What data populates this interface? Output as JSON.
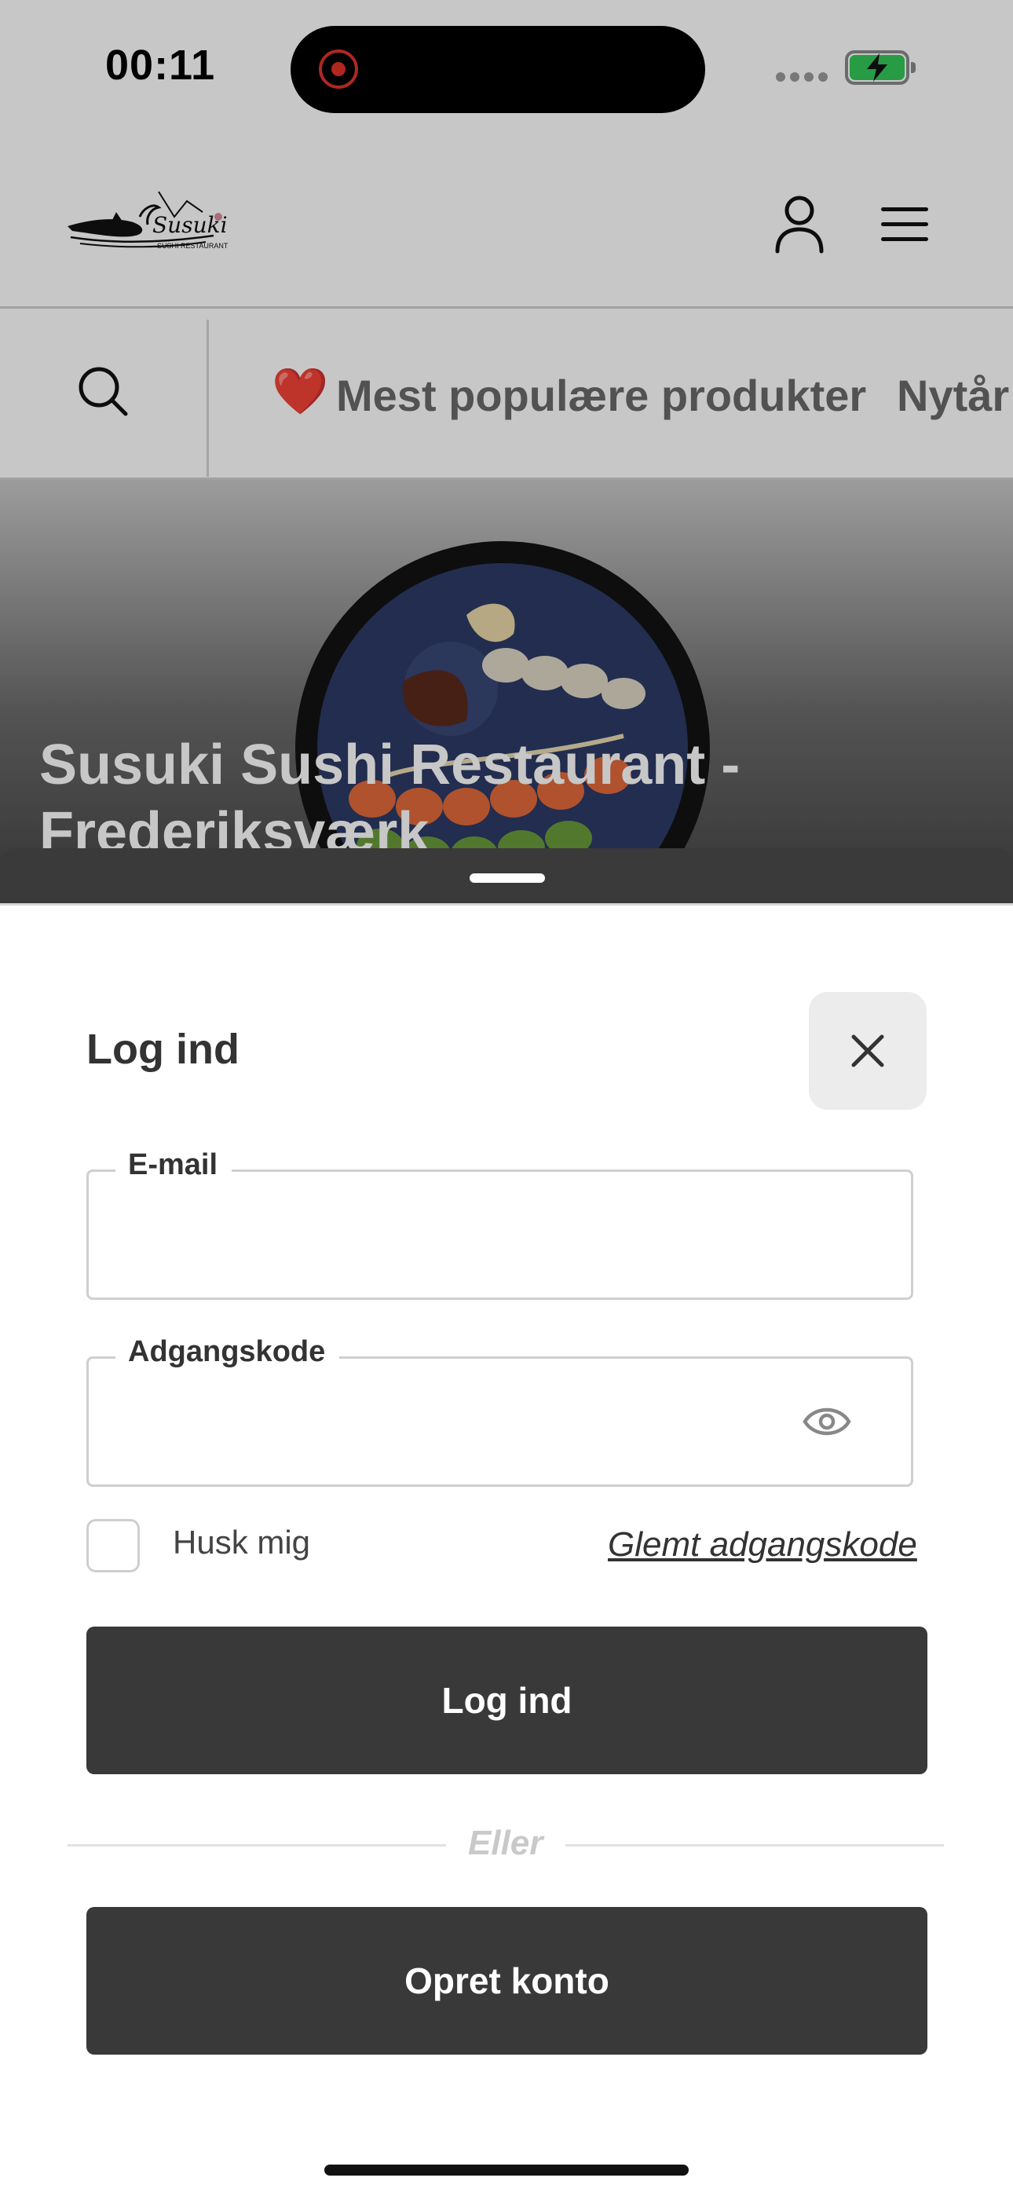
{
  "status_bar": {
    "time": "00:11",
    "battery_color": "#34c759",
    "recording_color": "#e0342a"
  },
  "header": {
    "logo_name": "Susuki",
    "logo_subtitle": "SUSHI RESTAURANT",
    "account_icon": "person-icon",
    "menu_icon": "hamburger-icon"
  },
  "category_bar": {
    "search_icon": "search-icon",
    "items": [
      {
        "emoji": "❤️",
        "label": "Mest populære produkter"
      },
      {
        "label": "Nytår"
      }
    ]
  },
  "hero": {
    "title": "Susuki Sushi Restaurant - Frederiksværk"
  },
  "login_sheet": {
    "title": "Log ind",
    "email_label": "E-mail",
    "email_value": "",
    "password_label": "Adgangskode",
    "password_value": "",
    "remember_label": "Husk mig",
    "remember_checked": false,
    "forgot_link": "Glemt adgangskode",
    "login_button": "Log ind",
    "divider_text": "Eller",
    "create_account_button": "Opret konto"
  },
  "colors": {
    "button_bg": "#393939",
    "heart": "#d81b22"
  }
}
